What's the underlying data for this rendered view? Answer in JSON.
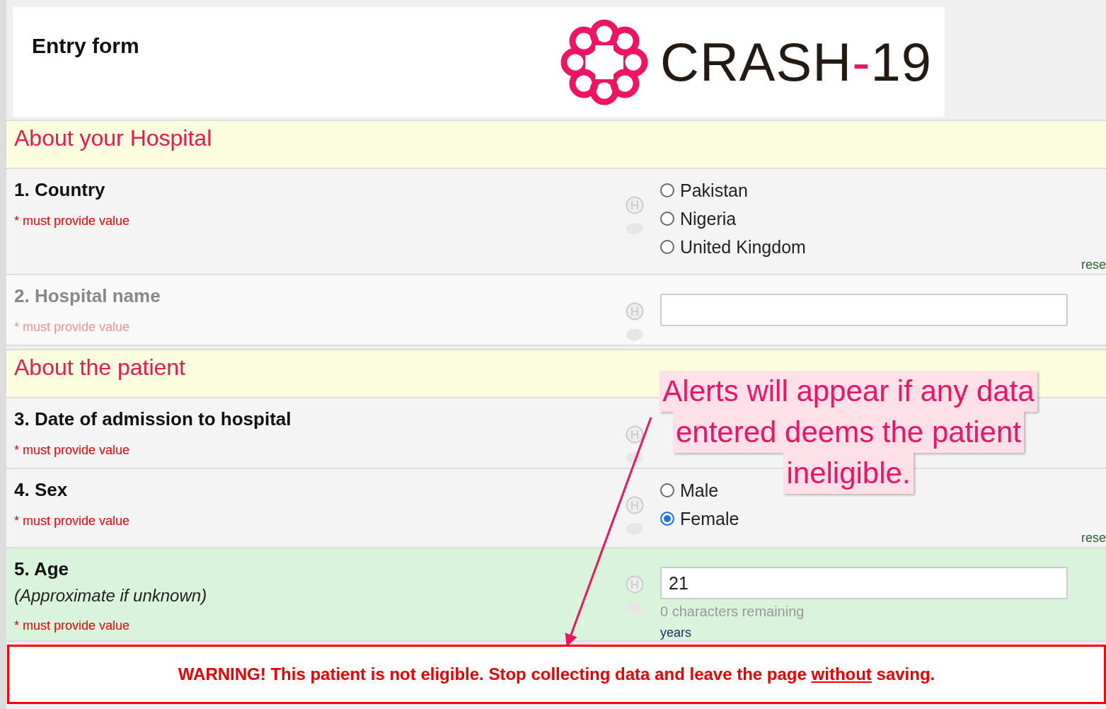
{
  "header": {
    "title": "Entry form",
    "logo": {
      "name": "CRASH",
      "separator": "-",
      "number": "19"
    }
  },
  "sections": [
    {
      "title": "About your Hospital",
      "questions": [
        {
          "label": "1. Country",
          "required": "* must provide value",
          "disabled": false,
          "highlighted": false,
          "field": {
            "kind": "radio",
            "options": [
              {
                "label": "Pakistan",
                "selected": false
              },
              {
                "label": "Nigeria",
                "selected": false
              },
              {
                "label": "United Kingdom",
                "selected": false
              }
            ]
          },
          "reset": "rese"
        },
        {
          "label": "2. Hospital name",
          "required": "* must provide value",
          "disabled": true,
          "highlighted": false,
          "field": {
            "kind": "text"
          }
        }
      ]
    },
    {
      "title": "About the patient",
      "questions": [
        {
          "label": "3. Date of admission to hospital",
          "required": "* must provide value",
          "disabled": false,
          "highlighted": false,
          "field": {
            "kind": "none"
          }
        },
        {
          "label": "4. Sex",
          "required": "* must provide value",
          "disabled": false,
          "highlighted": false,
          "field": {
            "kind": "radio",
            "options": [
              {
                "label": "Male",
                "selected": false
              },
              {
                "label": "Female",
                "selected": true
              }
            ]
          },
          "reset": "rese"
        },
        {
          "label": "5. Age",
          "note": "(Approximate if unknown)",
          "required": "* must provide value",
          "disabled": false,
          "highlighted": true,
          "field": {
            "kind": "text",
            "value": "21",
            "counter": "0 characters remaining",
            "unit": "years"
          }
        }
      ]
    }
  ],
  "warning": {
    "before": "WARNING! This patient is not eligible. Stop collecting data and leave the page ",
    "link": "without",
    "after": " saving."
  },
  "callout": {
    "lines": [
      "Alerts will appear if any data",
      "entered deems the patient",
      "ineligible."
    ]
  }
}
